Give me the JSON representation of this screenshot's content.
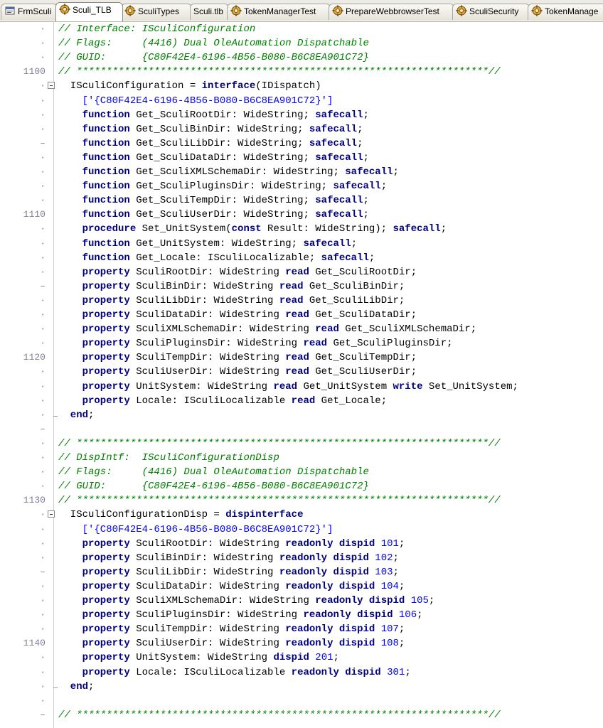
{
  "tabs": [
    {
      "label": "FrmSculi",
      "icon": "form-icon"
    },
    {
      "label": "Sculi_TLB",
      "icon": "unit-icon",
      "active": true
    },
    {
      "label": "SculiTypes",
      "icon": "unit-icon"
    },
    {
      "label": "Sculi.tlb",
      "icon": "none"
    },
    {
      "label": "TokenManagerTest",
      "icon": "unit-icon"
    },
    {
      "label": "PrepareWebbrowserTest",
      "icon": "unit-icon"
    },
    {
      "label": "SculiSecurity",
      "icon": "unit-icon"
    },
    {
      "label": "TokenManage",
      "icon": "unit-icon"
    }
  ],
  "lines": [
    {
      "n": "·",
      "t": [
        [
          "c",
          "// Interface: ISculiConfiguration"
        ]
      ]
    },
    {
      "n": "·",
      "t": [
        [
          "c",
          "// Flags:     (4416) Dual OleAutomation Dispatchable"
        ]
      ]
    },
    {
      "n": "·",
      "t": [
        [
          "c",
          "// GUID:      {C80F42E4-6196-4B56-B080-B6C8EA901C72}"
        ]
      ]
    },
    {
      "n": "1100",
      "t": [
        [
          "c",
          "// *********************************************************************//"
        ]
      ]
    },
    {
      "n": "·",
      "fold": true,
      "t": [
        [
          "p",
          "  ISculiConfiguration = "
        ],
        [
          "k",
          "interface"
        ],
        [
          "p",
          "(IDispatch)"
        ]
      ]
    },
    {
      "n": "·",
      "t": [
        [
          "s",
          "    ['{C80F42E4-6196-4B56-B080-B6C8EA901C72}']"
        ]
      ]
    },
    {
      "n": "·",
      "t": [
        [
          "k",
          "    function"
        ],
        [
          "p",
          " Get_SculiRootDir: WideString; "
        ],
        [
          "k",
          "safecall"
        ],
        [
          "p",
          ";"
        ]
      ]
    },
    {
      "n": "·",
      "t": [
        [
          "k",
          "    function"
        ],
        [
          "p",
          " Get_SculiBinDir: WideString; "
        ],
        [
          "k",
          "safecall"
        ],
        [
          "p",
          ";"
        ]
      ]
    },
    {
      "n": "–",
      "t": [
        [
          "k",
          "    function"
        ],
        [
          "p",
          " Get_SculiLibDir: WideString; "
        ],
        [
          "k",
          "safecall"
        ],
        [
          "p",
          ";"
        ]
      ]
    },
    {
      "n": "·",
      "t": [
        [
          "k",
          "    function"
        ],
        [
          "p",
          " Get_SculiDataDir: WideString; "
        ],
        [
          "k",
          "safecall"
        ],
        [
          "p",
          ";"
        ]
      ]
    },
    {
      "n": "·",
      "t": [
        [
          "k",
          "    function"
        ],
        [
          "p",
          " Get_SculiXMLSchemaDir: WideString; "
        ],
        [
          "k",
          "safecall"
        ],
        [
          "p",
          ";"
        ]
      ]
    },
    {
      "n": "·",
      "t": [
        [
          "k",
          "    function"
        ],
        [
          "p",
          " Get_SculiPluginsDir: WideString; "
        ],
        [
          "k",
          "safecall"
        ],
        [
          "p",
          ";"
        ]
      ]
    },
    {
      "n": "·",
      "t": [
        [
          "k",
          "    function"
        ],
        [
          "p",
          " Get_SculiTempDir: WideString; "
        ],
        [
          "k",
          "safecall"
        ],
        [
          "p",
          ";"
        ]
      ]
    },
    {
      "n": "1110",
      "t": [
        [
          "k",
          "    function"
        ],
        [
          "p",
          " Get_SculiUserDir: WideString; "
        ],
        [
          "k",
          "safecall"
        ],
        [
          "p",
          ";"
        ]
      ]
    },
    {
      "n": "·",
      "t": [
        [
          "k",
          "    procedure"
        ],
        [
          "p",
          " Set_UnitSystem("
        ],
        [
          "k",
          "const"
        ],
        [
          "p",
          " Result: WideString); "
        ],
        [
          "k",
          "safecall"
        ],
        [
          "p",
          ";"
        ]
      ]
    },
    {
      "n": "·",
      "t": [
        [
          "k",
          "    function"
        ],
        [
          "p",
          " Get_UnitSystem: WideString; "
        ],
        [
          "k",
          "safecall"
        ],
        [
          "p",
          ";"
        ]
      ]
    },
    {
      "n": "·",
      "t": [
        [
          "k",
          "    function"
        ],
        [
          "p",
          " Get_Locale: ISculiLocalizable; "
        ],
        [
          "k",
          "safecall"
        ],
        [
          "p",
          ";"
        ]
      ]
    },
    {
      "n": "·",
      "t": [
        [
          "k",
          "    property"
        ],
        [
          "p",
          " SculiRootDir: WideString "
        ],
        [
          "k",
          "read"
        ],
        [
          "p",
          " Get_SculiRootDir;"
        ]
      ]
    },
    {
      "n": "–",
      "t": [
        [
          "k",
          "    property"
        ],
        [
          "p",
          " SculiBinDir: WideString "
        ],
        [
          "k",
          "read"
        ],
        [
          "p",
          " Get_SculiBinDir;"
        ]
      ]
    },
    {
      "n": "·",
      "t": [
        [
          "k",
          "    property"
        ],
        [
          "p",
          " SculiLibDir: WideString "
        ],
        [
          "k",
          "read"
        ],
        [
          "p",
          " Get_SculiLibDir;"
        ]
      ]
    },
    {
      "n": "·",
      "t": [
        [
          "k",
          "    property"
        ],
        [
          "p",
          " SculiDataDir: WideString "
        ],
        [
          "k",
          "read"
        ],
        [
          "p",
          " Get_SculiDataDir;"
        ]
      ]
    },
    {
      "n": "·",
      "t": [
        [
          "k",
          "    property"
        ],
        [
          "p",
          " SculiXMLSchemaDir: WideString "
        ],
        [
          "k",
          "read"
        ],
        [
          "p",
          " Get_SculiXMLSchemaDir;"
        ]
      ]
    },
    {
      "n": "·",
      "t": [
        [
          "k",
          "    property"
        ],
        [
          "p",
          " SculiPluginsDir: WideString "
        ],
        [
          "k",
          "read"
        ],
        [
          "p",
          " Get_SculiPluginsDir;"
        ]
      ]
    },
    {
      "n": "1120",
      "t": [
        [
          "k",
          "    property"
        ],
        [
          "p",
          " SculiTempDir: WideString "
        ],
        [
          "k",
          "read"
        ],
        [
          "p",
          " Get_SculiTempDir;"
        ]
      ]
    },
    {
      "n": "·",
      "t": [
        [
          "k",
          "    property"
        ],
        [
          "p",
          " SculiUserDir: WideString "
        ],
        [
          "k",
          "read"
        ],
        [
          "p",
          " Get_SculiUserDir;"
        ]
      ]
    },
    {
      "n": "·",
      "t": [
        [
          "k",
          "    property"
        ],
        [
          "p",
          " UnitSystem: WideString "
        ],
        [
          "k",
          "read"
        ],
        [
          "p",
          " Get_UnitSystem "
        ],
        [
          "k",
          "write"
        ],
        [
          "p",
          " Set_UnitSystem;"
        ]
      ]
    },
    {
      "n": "·",
      "t": [
        [
          "k",
          "    property"
        ],
        [
          "p",
          " Locale: ISculiLocalizable "
        ],
        [
          "k",
          "read"
        ],
        [
          "p",
          " Get_Locale;"
        ]
      ]
    },
    {
      "n": "·",
      "foldend": true,
      "t": [
        [
          "k",
          "  end"
        ],
        [
          "p",
          ";"
        ]
      ]
    },
    {
      "n": "–",
      "t": []
    },
    {
      "n": "·",
      "t": [
        [
          "c",
          "// *********************************************************************//"
        ]
      ]
    },
    {
      "n": "·",
      "t": [
        [
          "c",
          "// DispIntf:  ISculiConfigurationDisp"
        ]
      ]
    },
    {
      "n": "·",
      "t": [
        [
          "c",
          "// Flags:     (4416) Dual OleAutomation Dispatchable"
        ]
      ]
    },
    {
      "n": "·",
      "t": [
        [
          "c",
          "// GUID:      {C80F42E4-6196-4B56-B080-B6C8EA901C72}"
        ]
      ]
    },
    {
      "n": "1130",
      "t": [
        [
          "c",
          "// *********************************************************************//"
        ]
      ]
    },
    {
      "n": "·",
      "fold": true,
      "t": [
        [
          "p",
          "  ISculiConfigurationDisp = "
        ],
        [
          "k",
          "dispinterface"
        ]
      ]
    },
    {
      "n": "·",
      "t": [
        [
          "s",
          "    ['{C80F42E4-6196-4B56-B080-B6C8EA901C72}']"
        ]
      ]
    },
    {
      "n": "·",
      "t": [
        [
          "k",
          "    property"
        ],
        [
          "p",
          " SculiRootDir: WideString "
        ],
        [
          "k",
          "readonly dispid"
        ],
        [
          "n",
          " 101"
        ],
        [
          "p",
          ";"
        ]
      ]
    },
    {
      "n": "·",
      "t": [
        [
          "k",
          "    property"
        ],
        [
          "p",
          " SculiBinDir: WideString "
        ],
        [
          "k",
          "readonly dispid"
        ],
        [
          "n",
          " 102"
        ],
        [
          "p",
          ";"
        ]
      ]
    },
    {
      "n": "–",
      "t": [
        [
          "k",
          "    property"
        ],
        [
          "p",
          " SculiLibDir: WideString "
        ],
        [
          "k",
          "readonly dispid"
        ],
        [
          "n",
          " 103"
        ],
        [
          "p",
          ";"
        ]
      ]
    },
    {
      "n": "·",
      "t": [
        [
          "k",
          "    property"
        ],
        [
          "p",
          " SculiDataDir: WideString "
        ],
        [
          "k",
          "readonly dispid"
        ],
        [
          "n",
          " 104"
        ],
        [
          "p",
          ";"
        ]
      ]
    },
    {
      "n": "·",
      "t": [
        [
          "k",
          "    property"
        ],
        [
          "p",
          " SculiXMLSchemaDir: WideString "
        ],
        [
          "k",
          "readonly dispid"
        ],
        [
          "n",
          " 105"
        ],
        [
          "p",
          ";"
        ]
      ]
    },
    {
      "n": "·",
      "t": [
        [
          "k",
          "    property"
        ],
        [
          "p",
          " SculiPluginsDir: WideString "
        ],
        [
          "k",
          "readonly dispid"
        ],
        [
          "n",
          " 106"
        ],
        [
          "p",
          ";"
        ]
      ]
    },
    {
      "n": "·",
      "t": [
        [
          "k",
          "    property"
        ],
        [
          "p",
          " SculiTempDir: WideString "
        ],
        [
          "k",
          "readonly dispid"
        ],
        [
          "n",
          " 107"
        ],
        [
          "p",
          ";"
        ]
      ]
    },
    {
      "n": "1140",
      "t": [
        [
          "k",
          "    property"
        ],
        [
          "p",
          " SculiUserDir: WideString "
        ],
        [
          "k",
          "readonly dispid"
        ],
        [
          "n",
          " 108"
        ],
        [
          "p",
          ";"
        ]
      ]
    },
    {
      "n": "·",
      "t": [
        [
          "k",
          "    property"
        ],
        [
          "p",
          " UnitSystem: WideString "
        ],
        [
          "k",
          "dispid"
        ],
        [
          "n",
          " 201"
        ],
        [
          "p",
          ";"
        ]
      ]
    },
    {
      "n": "·",
      "t": [
        [
          "k",
          "    property"
        ],
        [
          "p",
          " Locale: ISculiLocalizable "
        ],
        [
          "k",
          "readonly dispid"
        ],
        [
          "n",
          " 301"
        ],
        [
          "p",
          ";"
        ]
      ]
    },
    {
      "n": "·",
      "foldend": true,
      "t": [
        [
          "k",
          "  end"
        ],
        [
          "p",
          ";"
        ]
      ]
    },
    {
      "n": "·",
      "t": []
    },
    {
      "n": "–",
      "t": [
        [
          "c",
          "// *********************************************************************//"
        ]
      ]
    }
  ]
}
